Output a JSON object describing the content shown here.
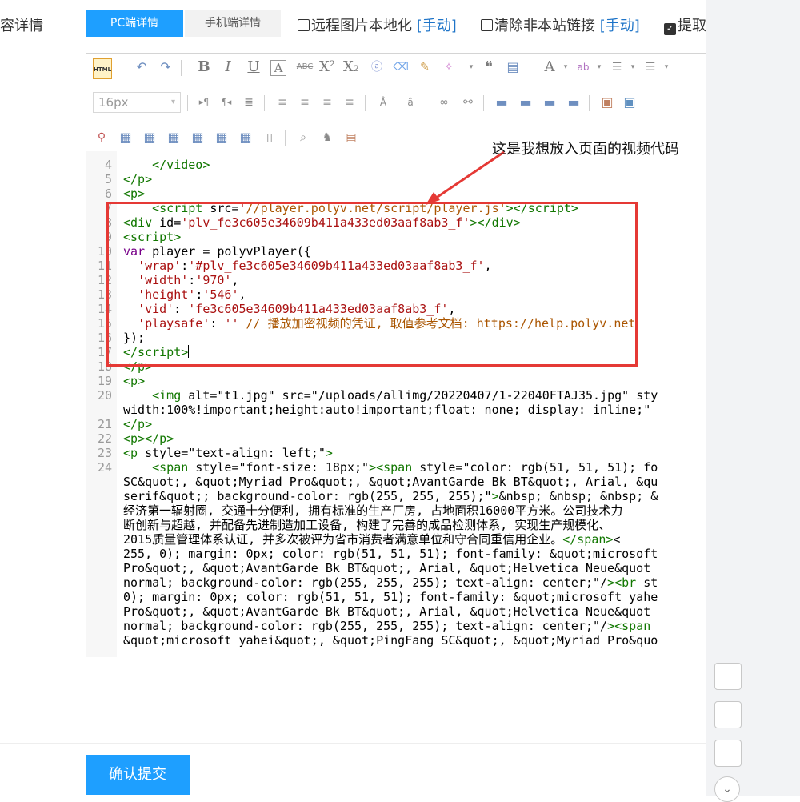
{
  "form": {
    "content_label": "容详情",
    "tabs": [
      {
        "label": "PC端详情",
        "active": true
      },
      {
        "label": "手机端详情",
        "active": false
      }
    ],
    "options": [
      {
        "label": "远程图片本地化",
        "manual": "[手动]",
        "checked": false
      },
      {
        "label": "清除非本站链接",
        "manual": "[手动]",
        "checked": false
      },
      {
        "label": "提取",
        "checked": true
      }
    ]
  },
  "editor": {
    "html_button": "HTML",
    "font_size": "16px",
    "annotation": "这是我想放入页面的视频代码",
    "code_lines": [
      {
        "n": "4",
        "html": "    &lt;/video&gt;"
      },
      {
        "n": "5",
        "html": "&lt;/p&gt;"
      },
      {
        "n": "6",
        "html": "&lt;p&gt;"
      },
      {
        "n": "7",
        "html": "    &lt;script src='//player.polyv.net/script/player.js'&gt;&lt;/script&gt;"
      },
      {
        "n": "8",
        "html": "&lt;div id='plv_fe3c605e34609b411a433ed03aaf8ab3_f'&gt;&lt;/div&gt;"
      },
      {
        "n": "9",
        "html": "&lt;script&gt;"
      },
      {
        "n": "10",
        "html": "var player = polyvPlayer({"
      },
      {
        "n": "11",
        "html": "  'wrap':'#plv_fe3c605e34609b411a433ed03aaf8ab3_f',"
      },
      {
        "n": "12",
        "html": "  'width':'970',"
      },
      {
        "n": "13",
        "html": "  'height':'546',"
      },
      {
        "n": "14",
        "html": "  'vid': 'fe3c605e34609b411a433ed03aaf8ab3_f',"
      },
      {
        "n": "15",
        "html": "  'playsafe': '' // 播放加密视频的凭证, 取值参考文档: https://help.polyv.net"
      },
      {
        "n": "16",
        "html": "});"
      },
      {
        "n": "17",
        "html": "&lt;/script&gt;"
      },
      {
        "n": "18",
        "html": "&lt;/p&gt;"
      },
      {
        "n": "19",
        "html": "&lt;p&gt;"
      },
      {
        "n": "20",
        "html": "    &lt;img alt=\"t1.jpg\" src=\"/uploads/allimg/20220407/1-22040FTAJ35.jpg\" sty"
      },
      {
        "n": "",
        "html": "width:100%!important;height:auto!important;float: none; display: inline;\""
      },
      {
        "n": "21",
        "html": "&lt;/p&gt;"
      },
      {
        "n": "22",
        "html": "&lt;p&gt;&lt;/p&gt;"
      },
      {
        "n": "23",
        "html": "&lt;p style=\"text-align: left;\"&gt;"
      },
      {
        "n": "24",
        "html": "    &lt;span style=\"font-size: 18px;\"&gt;&lt;span style=\"color: rgb(51, 51, 51); fo"
      },
      {
        "n": "",
        "html": "SC&amp;quot;, &amp;quot;Myriad Pro&amp;quot;, &amp;quot;AvantGarde Bk BT&amp;quot;, Arial, &amp;qu"
      },
      {
        "n": "",
        "html": "serif&amp;quot;; background-color: rgb(255, 255, 255);\"&gt;&amp;nbsp; &amp;nbsp; &amp;nbsp; &amp;"
      },
      {
        "n": "",
        "html": "经济第一辐射圈, 交通十分便利, 拥有标准的生产厂房, 占地面积16000平方米。公司技术力"
      },
      {
        "n": "",
        "html": "断创新与超越, 并配备先进制造加工设备, 构建了完善的成品检测体系, 实现生产规模化、"
      },
      {
        "n": "",
        "html": "2015质量管理体系认证, 并多次被评为省市消费者满意单位和守合同重信用企业。&lt;/span&gt;&lt;"
      },
      {
        "n": "",
        "html": "255, 0); margin: 0px; color: rgb(51, 51, 51); font-family: &amp;quot;microsoft"
      },
      {
        "n": "",
        "html": "Pro&amp;quot;, &amp;quot;AvantGarde Bk BT&amp;quot;, Arial, &amp;quot;Helvetica Neue&amp;quot"
      },
      {
        "n": "",
        "html": "normal; background-color: rgb(255, 255, 255); text-align: center;\"/&gt;&lt;br st"
      },
      {
        "n": "",
        "html": "0); margin: 0px; color: rgb(51, 51, 51); font-family: &amp;quot;microsoft yahe"
      },
      {
        "n": "",
        "html": "Pro&amp;quot;, &amp;quot;AvantGarde Bk BT&amp;quot;, Arial, &amp;quot;Helvetica Neue&amp;quot"
      },
      {
        "n": "",
        "html": "normal; background-color: rgb(255, 255, 255); text-align: center;\"/&gt;&lt;span"
      },
      {
        "n": "",
        "html": "&amp;quot;microsoft yahei&amp;quot;, &amp;quot;PingFang SC&amp;quot;, &amp;quot;Myriad Pro&amp;quo"
      }
    ]
  },
  "footer": {
    "submit_label": "确认提交"
  },
  "colors": {
    "primary": "#1e9fff",
    "highlight_box": "#e53935"
  }
}
